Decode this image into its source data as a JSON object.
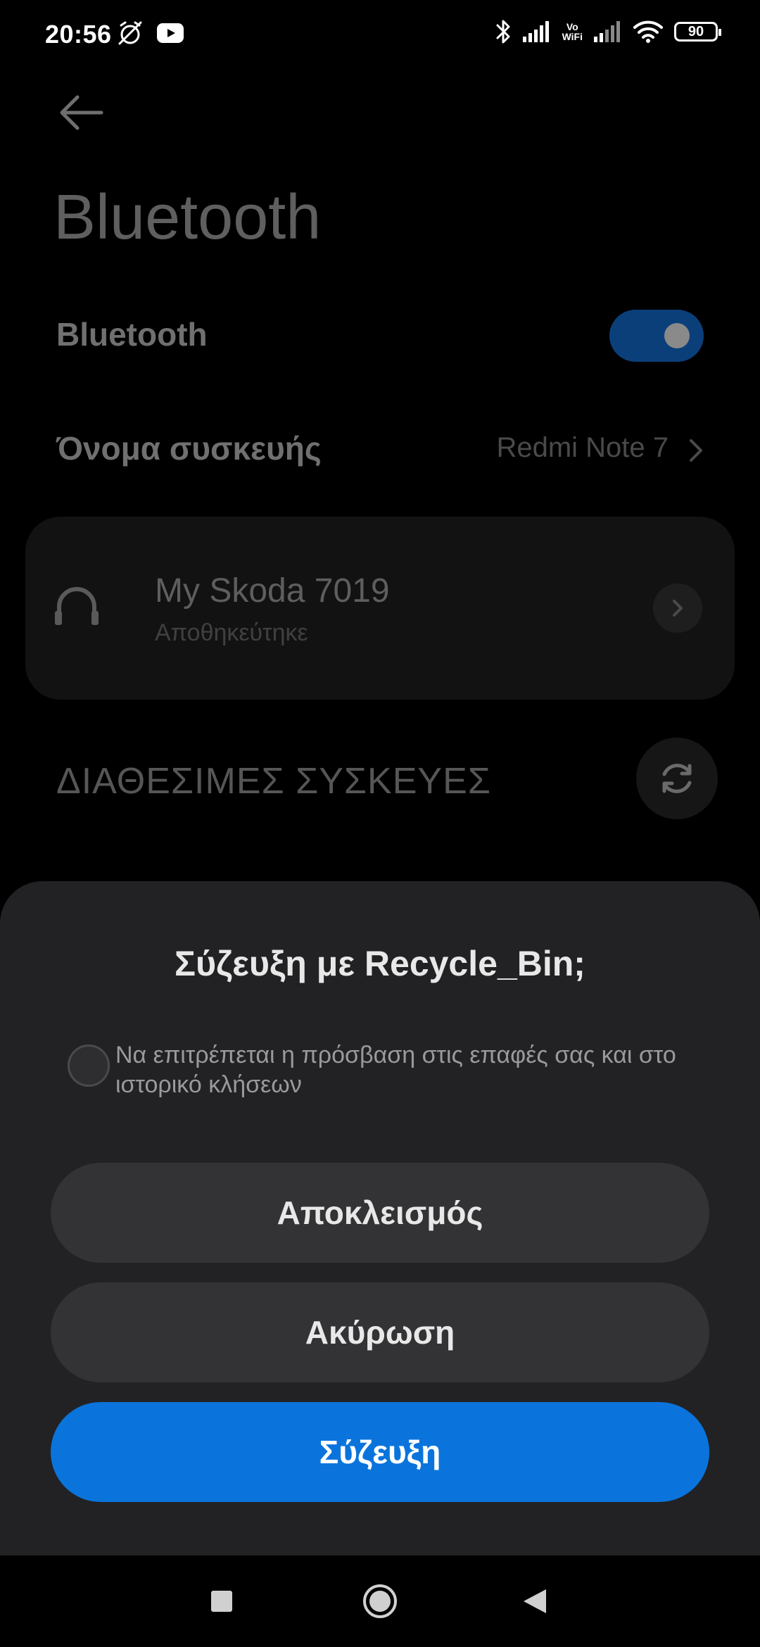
{
  "status_bar": {
    "time": "20:56",
    "vowifi_top": "Vo",
    "vowifi_bottom": "WiFi",
    "battery": "90"
  },
  "page": {
    "title": "Bluetooth",
    "bluetooth_label": "Bluetooth",
    "bluetooth_enabled": true,
    "device_name_label": "Όνομα συσκευής",
    "device_name_value": "Redmi Note 7",
    "saved_device": {
      "name": "My Skoda 7019",
      "status": "Αποθηκεύτηκε"
    },
    "available_devices_heading": "ΔΙΑΘΕΣΙΜΕΣ ΣΥΣΚΕΥΕΣ"
  },
  "dialog": {
    "title": "Σύζευξη με Recycle_Bin;",
    "checkbox_label": "Να επιτρέπεται η πρόσβαση στις επαφές σας και στο ιστορικό κλήσεων",
    "checkbox_checked": false,
    "block_label": "Αποκλεισμός",
    "cancel_label": "Ακύρωση",
    "pair_label": "Σύζευξη"
  },
  "colors": {
    "accent": "#0a74dc",
    "dialog_bg": "#222224",
    "toggle_on": "#0b3f7a"
  }
}
